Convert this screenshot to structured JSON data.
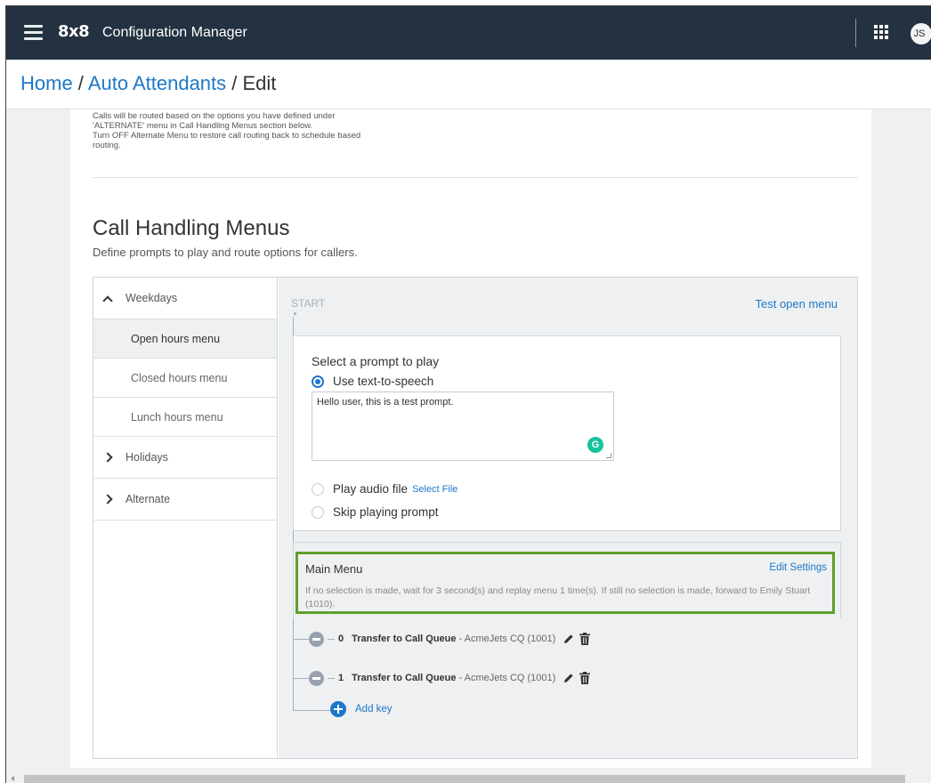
{
  "topbar": {
    "logo": "8x8",
    "app_title": "Configuration Manager",
    "avatar_initials": "JS"
  },
  "breadcrumb": {
    "home": "Home",
    "sep1": " / ",
    "section": "Auto Attendants",
    "sep2": " / ",
    "current": "Edit"
  },
  "alternate_note": {
    "line1": "Calls will be routed based on the options you have defined under",
    "line2": "'ALTERNATE' menu in Call Handling Menus section below.",
    "line3": "Turn OFF Alternate Menu to restore call routing back to schedule based",
    "line4": "routing."
  },
  "call_handling": {
    "title": "Call Handling Menus",
    "subtitle": "Define prompts to play and route options for callers."
  },
  "sidebar": {
    "weekdays_label": "Weekdays",
    "items": [
      "Open hours menu",
      "Closed hours menu",
      "Lunch hours menu"
    ],
    "active_item": "Open hours menu",
    "holidays_label": "Holidays",
    "alternate_label": "Alternate"
  },
  "flow": {
    "start_label": "START",
    "test_link": "Test open menu"
  },
  "prompt": {
    "title": "Select a prompt to play",
    "options": {
      "tts": "Use text-to-speech",
      "audio": "Play audio file",
      "audio_link": "Select File",
      "skip": "Skip playing prompt"
    },
    "selected": "tts",
    "tts_text": "Hello user, this is a test prompt.",
    "grammarly_badge": "G"
  },
  "main_menu": {
    "title": "Main Menu",
    "edit_link": "Edit Settings",
    "description": "If no selection is made, wait for 3 second(s) and replay menu 1 time(s). If still no selection is made, forward to Emily Stuart (1010)."
  },
  "keys": [
    {
      "key": "0",
      "action": "Transfer to Call Queue",
      "target": "- AcmeJets CQ (1001)"
    },
    {
      "key": "1",
      "action": "Transfer to Call Queue",
      "target": "- AcmeJets CQ (1001)"
    }
  ],
  "add_key_label": "Add key",
  "colors": {
    "topbar_bg": "#233140",
    "link": "#1e78c8",
    "highlight": "#5ea02a",
    "grammarly": "#15c39a"
  },
  "icons": [
    "hamburger-icon",
    "apps-grid-icon",
    "chevron-up-icon",
    "chevron-right-icon",
    "minus-circle-icon",
    "pencil-icon",
    "trash-icon",
    "plus-circle-icon",
    "grammarly-icon"
  ]
}
